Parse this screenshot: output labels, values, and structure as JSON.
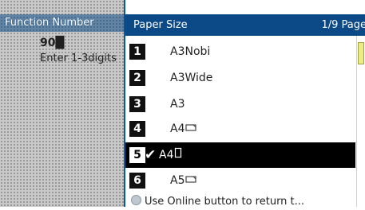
{
  "left_panel": {
    "header": "Function Number",
    "code": "90█",
    "hint": "Enter 1-3digits"
  },
  "menu": {
    "title": "Paper Size",
    "page_indicator": "1/9 Page",
    "items": [
      {
        "number": "1",
        "label": "A3Nobi",
        "orientation_icon": ""
      },
      {
        "number": "2",
        "label": "A3Wide",
        "orientation_icon": ""
      },
      {
        "number": "3",
        "label": "A3",
        "orientation_icon": ""
      },
      {
        "number": "4",
        "label": "A4",
        "orientation_icon": "landscape-page-icon"
      },
      {
        "number": "5",
        "label": "A4",
        "orientation_icon": "portrait-page-icon",
        "selected": true,
        "check": "✔"
      },
      {
        "number": "6",
        "label": "A5",
        "orientation_icon": "landscape-page-icon"
      }
    ],
    "footer": "Use Online button to return t..."
  },
  "colors": {
    "header_blue": "#0b4a87",
    "selected_bg": "#000000",
    "scroll_thumb": "#ecec86"
  }
}
